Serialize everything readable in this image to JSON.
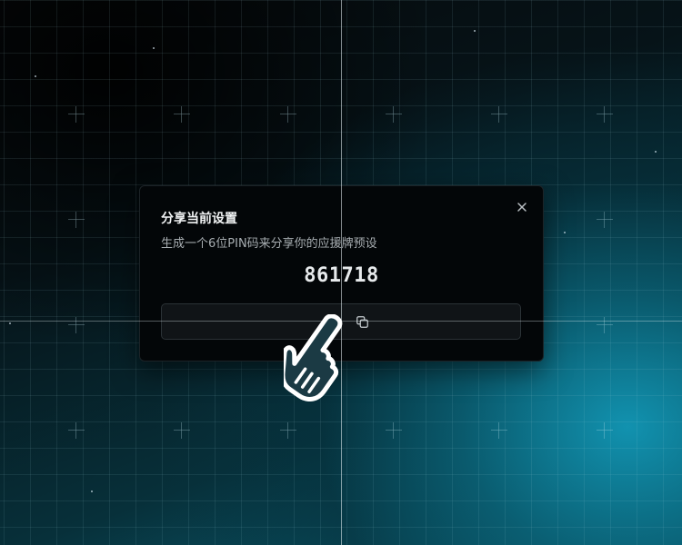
{
  "dialog": {
    "title": "分享当前设置",
    "description": "生成一个6位PIN码来分享你的应援牌预设",
    "pin_code": "861718",
    "close_icon": "close-icon",
    "copy_icon": "copy-icon"
  },
  "cursor": {
    "icon": "pointing-hand-cursor-icon"
  },
  "colors": {
    "dialog_background": "#030608",
    "accent_glow": "#1296b4",
    "text_primary": "#f1f3f4",
    "text_secondary": "#a7adb1"
  }
}
